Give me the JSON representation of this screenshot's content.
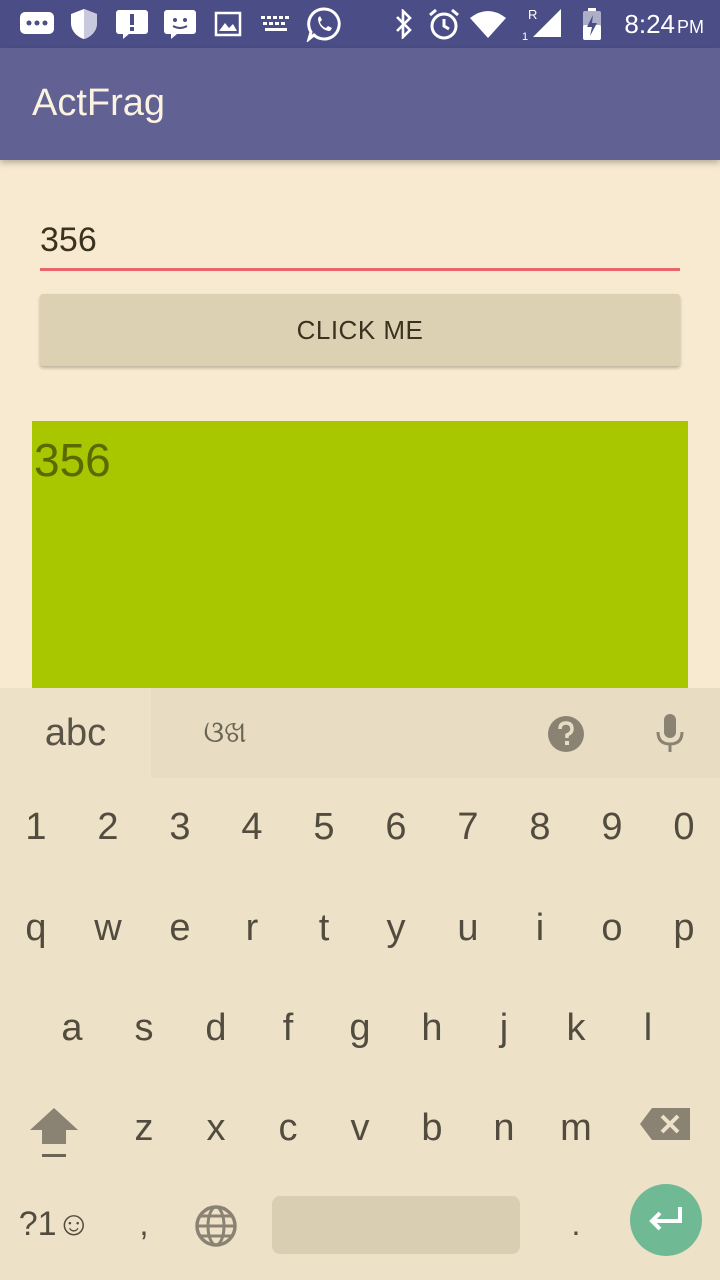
{
  "status_bar": {
    "time": "8:24",
    "ampm": "PM",
    "icons": [
      "messages-icon",
      "shield-icon",
      "alert-icon",
      "face-icon",
      "image-icon",
      "keyboard-icon",
      "whatsapp-icon",
      "bluetooth-icon",
      "alarm-icon",
      "wifi-icon",
      "signal-icon",
      "battery-charging-icon"
    ],
    "roaming_label": "R",
    "sim_label": "1"
  },
  "app_bar": {
    "title": "ActFrag"
  },
  "edit_text": {
    "value": "356"
  },
  "button": {
    "label": "CLICK ME"
  },
  "fragment": {
    "text": "356",
    "color": "#a8c700"
  },
  "keyboard": {
    "tab_abc": "abc",
    "tab_alt": "ଓଖ",
    "number_row": [
      "1",
      "2",
      "3",
      "4",
      "5",
      "6",
      "7",
      "8",
      "9",
      "0"
    ],
    "row1": [
      "q",
      "w",
      "e",
      "r",
      "t",
      "y",
      "u",
      "i",
      "o",
      "p"
    ],
    "row2": [
      "a",
      "s",
      "d",
      "f",
      "g",
      "h",
      "j",
      "k",
      "l"
    ],
    "row3": [
      "z",
      "x",
      "c",
      "v",
      "b",
      "n",
      "m"
    ],
    "symbols_label": "?1☺",
    "comma": ",",
    "period": ".",
    "enter_color": "#6fba94"
  },
  "colors": {
    "status_bar": "#4b4d86",
    "app_bar": "#616193",
    "background": "#f7ead0",
    "accent_underline": "#e9646b"
  }
}
